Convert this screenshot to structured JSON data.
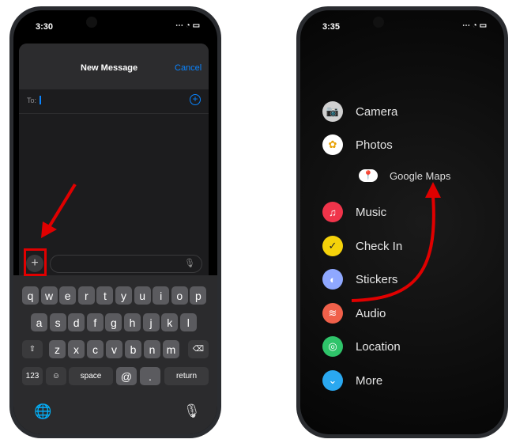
{
  "left": {
    "time": "3:30",
    "title": "New Message",
    "cancel": "Cancel",
    "to_label": "To:",
    "keyboard": {
      "row1": [
        "q",
        "w",
        "e",
        "r",
        "t",
        "y",
        "u",
        "i",
        "o",
        "p"
      ],
      "row2": [
        "a",
        "s",
        "d",
        "f",
        "g",
        "h",
        "j",
        "k",
        "l"
      ],
      "row3": [
        "z",
        "x",
        "c",
        "v",
        "b",
        "n",
        "m"
      ],
      "numbers": "123",
      "space": "space",
      "at": "@",
      "period": ".",
      "return": "return"
    },
    "accent": "#0a84ff",
    "annotation_color": "#e00000"
  },
  "right": {
    "time": "3:35",
    "menu": [
      {
        "label": "Camera",
        "icon": "camera-icon",
        "color": "#d0d0d0"
      },
      {
        "label": "Photos",
        "icon": "photos-icon",
        "color": "#ffffff"
      },
      {
        "label": "Music",
        "icon": "music-icon",
        "color": "#f0344a"
      },
      {
        "label": "Check In",
        "icon": "check-icon",
        "color": "#f5d20a"
      },
      {
        "label": "Stickers",
        "icon": "stickers-icon",
        "color": "#8fa8ff"
      },
      {
        "label": "Audio",
        "icon": "audio-icon",
        "color": "#f0604a"
      },
      {
        "label": "Location",
        "icon": "location-icon",
        "color": "#2fc46a"
      },
      {
        "label": "More",
        "icon": "more-icon",
        "color": "#2aa8f0"
      }
    ],
    "dragged": {
      "label": "Google Maps",
      "icon": "google-maps-icon"
    }
  }
}
